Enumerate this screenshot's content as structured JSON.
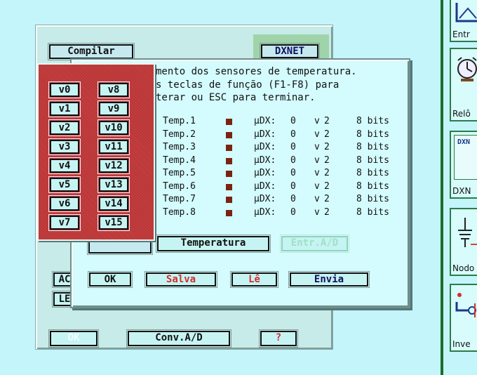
{
  "back_dialog": {
    "compile_label": "Compilar",
    "dxnet_label": "DXNET",
    "ac_label": "AC",
    "le_label": "LE",
    "ok_label": "OK",
    "conv_label": "Conv.A/D",
    "help_label": "?"
  },
  "sensor_dialog": {
    "info_lines": [
      "mento dos sensores de temperatura.",
      "s teclas de função (F1-F8) para",
      "terar ou ESC para terminar."
    ],
    "rows": [
      {
        "name": "Temp.1",
        "udx": "µDX:",
        "addr": "0",
        "v": "v",
        "vnum": "2",
        "bits": "8 bits"
      },
      {
        "name": "Temp.2",
        "udx": "µDX:",
        "addr": "0",
        "v": "v",
        "vnum": "2",
        "bits": "8 bits"
      },
      {
        "name": "Temp.3",
        "udx": "µDX:",
        "addr": "0",
        "v": "v",
        "vnum": "2",
        "bits": "8 bits"
      },
      {
        "name": "Temp.4",
        "udx": "µDX:",
        "addr": "0",
        "v": "v",
        "vnum": "2",
        "bits": "8 bits"
      },
      {
        "name": "Temp.5",
        "udx": "µDX:",
        "addr": "0",
        "v": "v",
        "vnum": "2",
        "bits": "8 bits"
      },
      {
        "name": "Temp.6",
        "udx": "µDX:",
        "addr": "0",
        "v": "v",
        "vnum": "2",
        "bits": "8 bits"
      },
      {
        "name": "Temp.7",
        "udx": "µDX:",
        "addr": "0",
        "v": "v",
        "vnum": "2",
        "bits": "8 bits"
      },
      {
        "name": "Temp.8",
        "udx": "µDX:",
        "addr": "0",
        "v": "v",
        "vnum": "2",
        "bits": "8 bits"
      }
    ],
    "tab_temperature": "Temperatura",
    "tab_entr": "Entr.A/D",
    "tab_left": "",
    "ok_label": "OK",
    "save_label": "Salva",
    "read_label": "Lê",
    "send_label": "Envia"
  },
  "variables": [
    "v0",
    "v8",
    "v1",
    "v9",
    "v2",
    "v10",
    "v3",
    "v11",
    "v4",
    "v12",
    "v5",
    "v13",
    "v6",
    "v14",
    "v7",
    "v15"
  ],
  "palette": {
    "items": [
      "Entr",
      "Relô",
      "DXN",
      "Nodo",
      "Inve"
    ]
  },
  "colors": {
    "background": "#c3f5fb",
    "panel_red": "#c63d3d",
    "swatch": "#7a2410",
    "divider": "#1d6d2a"
  }
}
